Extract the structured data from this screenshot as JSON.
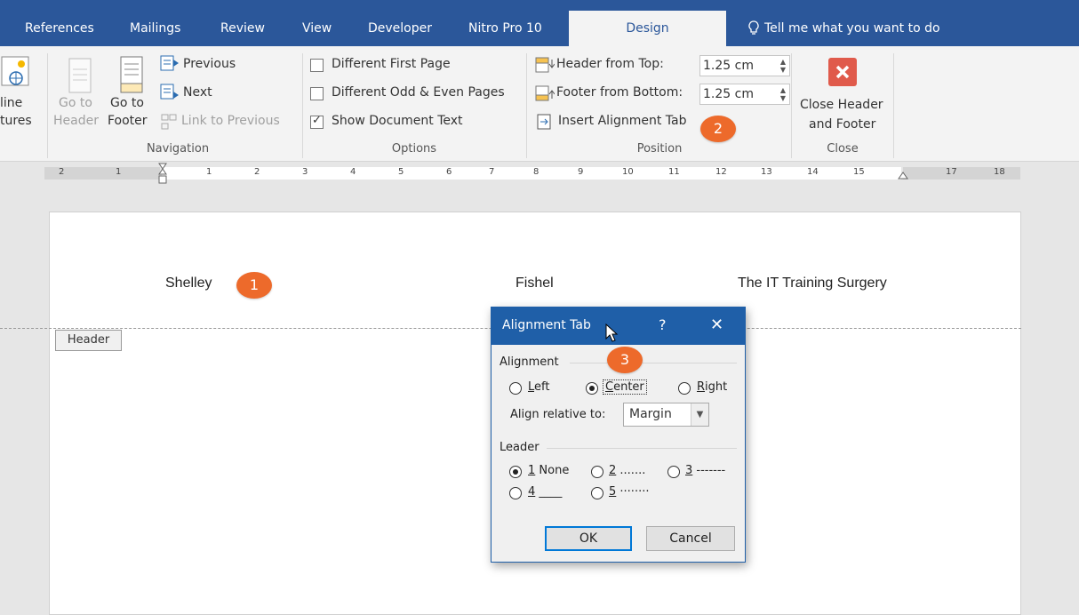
{
  "tabs": [
    {
      "label": "References"
    },
    {
      "label": "Mailings"
    },
    {
      "label": "Review"
    },
    {
      "label": "View"
    },
    {
      "label": "Developer"
    },
    {
      "label": "Nitro Pro 10"
    },
    {
      "label": "Design"
    }
  ],
  "tell_me": "Tell me what you want to do",
  "ribbon": {
    "insert_cut": {
      "line1": "line",
      "line2": "tures"
    },
    "navigation": {
      "go_to_header_l1": "Go to",
      "go_to_header_l2": "Header",
      "go_to_footer_l1": "Go to",
      "go_to_footer_l2": "Footer",
      "previous": "Previous",
      "next": "Next",
      "link_to_previous": "Link to Previous",
      "label": "Navigation"
    },
    "options": {
      "different_first_page": "Different First Page",
      "different_odd_even": "Different Odd & Even Pages",
      "show_document_text": "Show Document Text",
      "show_document_text_checked": true,
      "label": "Options"
    },
    "position": {
      "header_from_top": "Header from Top:",
      "header_value": "1.25 cm",
      "footer_from_bottom": "Footer from Bottom:",
      "footer_value": "1.25 cm",
      "insert_alignment_tab": "Insert Alignment Tab",
      "label": "Position"
    },
    "close": {
      "line1": "Close Header",
      "line2": "and Footer",
      "label": "Close"
    }
  },
  "ruler": {
    "numbers": [
      "2",
      "1",
      "1",
      "2",
      "3",
      "4",
      "5",
      "6",
      "7",
      "8",
      "9",
      "10",
      "11",
      "12",
      "13",
      "14",
      "15",
      "17",
      "18"
    ]
  },
  "document": {
    "header_left": "Shelley",
    "header_center": "Fishel",
    "header_right": "The IT Training Surgery",
    "header_tag": "Header"
  },
  "badges": [
    "1",
    "2",
    "3"
  ],
  "dialog": {
    "title": "Alignment Tab",
    "help": "?",
    "close": "✕",
    "alignment_label": "Alignment",
    "left_key": "L",
    "left_rest": "eft",
    "center_key": "C",
    "center_rest": "enter",
    "right_key": "R",
    "right_rest": "ight",
    "align_relative_label": "Align relative to:",
    "align_relative_value": "Margin",
    "leader_label": "Leader",
    "leader1_key": "1",
    "leader1_rest": " None",
    "leader2_key": "2",
    "leader2_rest": " .......",
    "leader3_key": "3",
    "leader3_rest": " -------",
    "leader4_key": "4",
    "leader4_rest": " ____",
    "leader5_key": "5",
    "leader5_rest": " ········",
    "ok": "OK",
    "cancel": "Cancel"
  },
  "colors": {
    "accent": "#2b579a",
    "dialog_title": "#1f5fa8",
    "badge": "#ed6a2b",
    "close_button": "#e05a4b"
  }
}
